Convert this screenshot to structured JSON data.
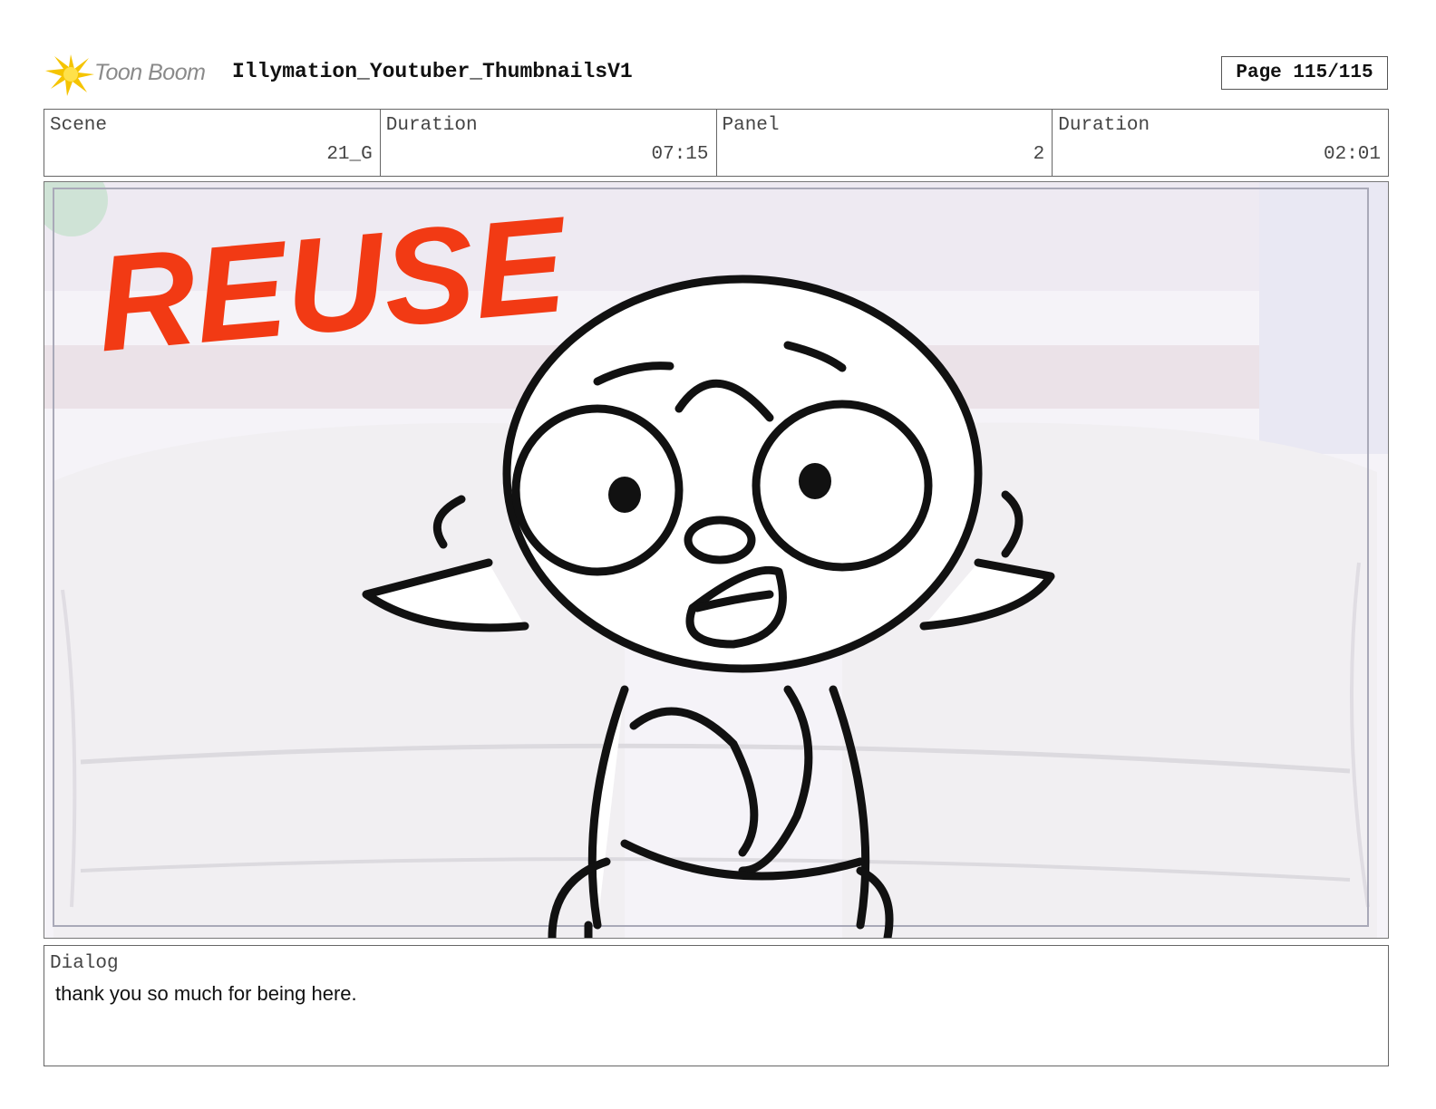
{
  "header": {
    "logo_text": "Toon Boom",
    "project_title": "Illymation_Youtuber_ThumbnailsV1",
    "page_label": "Page 115/115"
  },
  "info": {
    "scene_label": "Scene",
    "scene_value": "21_G",
    "scene_duration_label": "Duration",
    "scene_duration_value": "07:15",
    "panel_label": "Panel",
    "panel_value": "2",
    "panel_duration_label": "Duration",
    "panel_duration_value": "02:01"
  },
  "panel": {
    "stamp_text": "REUSE",
    "stamp_color": "#f23a14"
  },
  "dialog": {
    "label": "Dialog",
    "text": "thank you so much for being here."
  }
}
